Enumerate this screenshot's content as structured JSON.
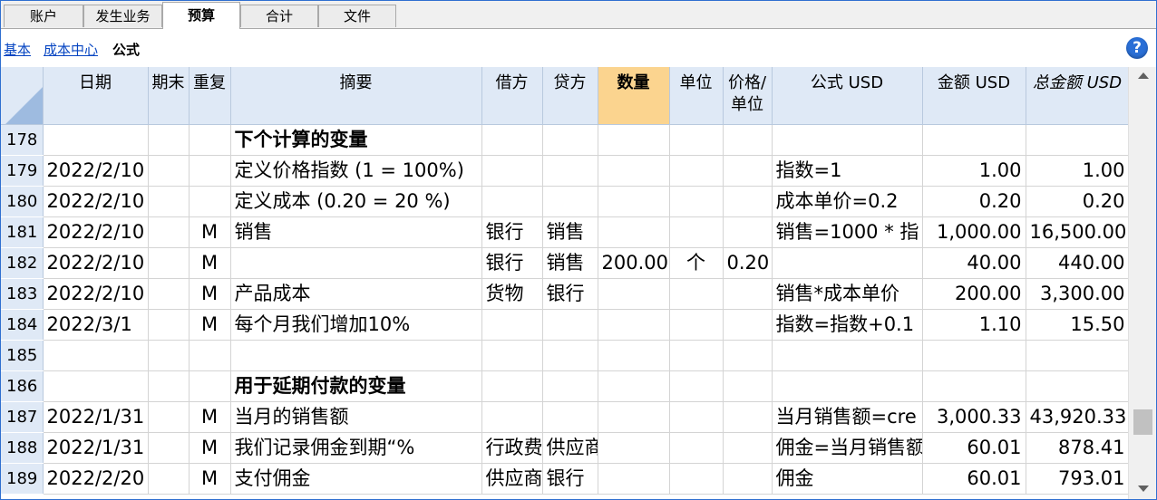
{
  "tabs": [
    {
      "label": "账户"
    },
    {
      "label": "发生业务"
    },
    {
      "label": "预算"
    },
    {
      "label": "合计"
    },
    {
      "label": "文件"
    }
  ],
  "subnav": {
    "links": [
      "基本",
      "成本中心"
    ],
    "current": "公式"
  },
  "help_icon": "?",
  "columns": {
    "date": "日期",
    "period_end": "期末",
    "repeat": "重复",
    "description": "摘要",
    "debit": "借方",
    "credit": "贷方",
    "quantity": "数量",
    "unit": "单位",
    "price_unit_1": "价格/",
    "price_unit_2": "单位",
    "formula": "公式 USD",
    "amount": "金额 USD",
    "total": "总金额 USD"
  },
  "rows": [
    {
      "num": "178",
      "date": "",
      "end": "",
      "rep": "",
      "desc": "下个计算的变量",
      "debit": "",
      "credit": "",
      "qty": "",
      "unit": "",
      "price": "",
      "formula": "",
      "amount": "",
      "total": ""
    },
    {
      "num": "179",
      "date": "2022/2/10",
      "end": "",
      "rep": "",
      "desc": "定义价格指数 (1 = 100%)",
      "debit": "",
      "credit": "",
      "qty": "",
      "unit": "",
      "price": "",
      "formula": "指数=1",
      "amount": "1.00",
      "total": "1.00"
    },
    {
      "num": "180",
      "date": "2022/2/10",
      "end": "",
      "rep": "",
      "desc": "定义成本 (0.20 = 20 %)",
      "debit": "",
      "credit": "",
      "qty": "",
      "unit": "",
      "price": "",
      "formula": "成本单价=0.2",
      "amount": "0.20",
      "total": "0.20"
    },
    {
      "num": "181",
      "date": "2022/2/10",
      "end": "",
      "rep": "M",
      "desc": "销售",
      "debit": "银行",
      "credit": "销售",
      "qty": "",
      "unit": "",
      "price": "",
      "formula": "销售=1000 * 指",
      "amount": "1,000.00",
      "total": "16,500.00"
    },
    {
      "num": "182",
      "date": "2022/2/10",
      "end": "",
      "rep": "M",
      "desc": "",
      "debit": "银行",
      "credit": "销售",
      "qty": "200.00",
      "unit": "个",
      "price": "0.20",
      "formula": "",
      "amount": "40.00",
      "total": "440.00"
    },
    {
      "num": "183",
      "date": "2022/2/10",
      "end": "",
      "rep": "M",
      "desc": "产品成本",
      "debit": "货物",
      "credit": "银行",
      "qty": "",
      "unit": "",
      "price": "",
      "formula": "销售*成本单价",
      "amount": "200.00",
      "total": "3,300.00"
    },
    {
      "num": "184",
      "date": "2022/3/1",
      "end": "",
      "rep": "M",
      "desc": "每个月我们增加10%",
      "debit": "",
      "credit": "",
      "qty": "",
      "unit": "",
      "price": "",
      "formula": "指数=指数+0.1",
      "amount": "1.10",
      "total": "15.50"
    },
    {
      "num": "185",
      "date": "",
      "end": "",
      "rep": "",
      "desc": "",
      "debit": "",
      "credit": "",
      "qty": "",
      "unit": "",
      "price": "",
      "formula": "",
      "amount": "",
      "total": ""
    },
    {
      "num": "186",
      "date": "",
      "end": "",
      "rep": "",
      "desc": "用于延期付款的变量",
      "debit": "",
      "credit": "",
      "qty": "",
      "unit": "",
      "price": "",
      "formula": "",
      "amount": "",
      "total": ""
    },
    {
      "num": "187",
      "date": "2022/1/31",
      "end": "",
      "rep": "M",
      "desc": "当月的销售额",
      "debit": "",
      "credit": "",
      "qty": "",
      "unit": "",
      "price": "",
      "formula": "当月销售额=cre",
      "amount": "3,000.33",
      "total": "43,920.33"
    },
    {
      "num": "188",
      "date": "2022/1/31",
      "end": "",
      "rep": "M",
      "desc": "我们记录佣金到期“%",
      "debit": "行政费",
      "credit": "供应商",
      "qty": "",
      "unit": "",
      "price": "",
      "formula": "佣金=当月销售额",
      "amount": "60.01",
      "total": "878.41"
    },
    {
      "num": "189",
      "date": "2022/2/20",
      "end": "",
      "rep": "M",
      "desc": "支付佣金",
      "debit": "供应商",
      "credit": "银行",
      "qty": "",
      "unit": "",
      "price": "",
      "formula": "佣金",
      "amount": "60.01",
      "total": "793.01"
    }
  ],
  "bold_rows": [
    "178",
    "186"
  ],
  "scroll": {
    "position": 0.88
  }
}
